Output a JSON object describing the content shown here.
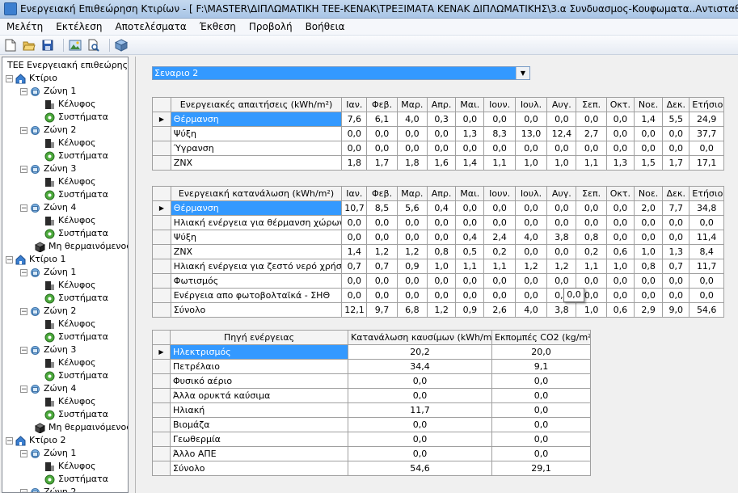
{
  "window": {
    "title": "Ενεργειακή Επιθεώρηση Κτιρίων - [ F:\\MASTER\\ΔΙΠΛΩΜΑΤΙΚΗ ΤΕΕ-ΚΕΝΑΚ\\ΤΡΕΞΙΜΑΤΑ ΚΕΝΑΚ ΔΙΠΛΩΜΑΤΙΚΗΣ\\3.α Συνδυασμος-Κουφωματα..Αντισταθμιση Γ..Ηλιακο"
  },
  "menu": [
    "Μελέτη",
    "Εκτέλεση",
    "Αποτελέσματα",
    "Έκθεση",
    "Προβολή",
    "Βοήθεια"
  ],
  "toolbar": [
    "new-file-icon",
    "open-folder-icon",
    "save-icon",
    "image-icon",
    "print-preview-icon",
    "package-icon"
  ],
  "tree": {
    "root": "ΤΕΕ Ενεργειακή επιθεώρης",
    "buildings": [
      {
        "label": "Κτίριο",
        "zones": [
          {
            "label": "Ζώνη 1",
            "children": [
              "Κέλυφος",
              "Συστήματα"
            ]
          },
          {
            "label": "Ζώνη 2",
            "children": [
              "Κέλυφος",
              "Συστήματα"
            ]
          },
          {
            "label": "Ζώνη 3",
            "children": [
              "Κέλυφος",
              "Συστήματα"
            ]
          },
          {
            "label": "Ζώνη 4",
            "children": [
              "Κέλυφος",
              "Συστήματα"
            ]
          }
        ],
        "unheated": "Μη θερμαινόμενος"
      },
      {
        "label": "Κτίριο 1",
        "zones": [
          {
            "label": "Ζώνη 1",
            "children": [
              "Κέλυφος",
              "Συστήματα"
            ]
          },
          {
            "label": "Ζώνη 2",
            "children": [
              "Κέλυφος",
              "Συστήματα"
            ]
          },
          {
            "label": "Ζώνη 3",
            "children": [
              "Κέλυφος",
              "Συστήματα"
            ]
          },
          {
            "label": "Ζώνη 4",
            "children": [
              "Κέλυφος",
              "Συστήματα"
            ]
          }
        ],
        "unheated": "Μη θερμαινόμενος"
      },
      {
        "label": "Κτίριο 2",
        "zones": [
          {
            "label": "Ζώνη 1",
            "children": [
              "Κέλυφος",
              "Συστήματα"
            ]
          },
          {
            "label": "Ζώνη 2",
            "children": []
          }
        ]
      }
    ]
  },
  "scenario": {
    "selected": "Σεναριο 2"
  },
  "months": [
    "Ιαν.",
    "Φεβ.",
    "Μαρ.",
    "Απρ.",
    "Μαι.",
    "Ιουν.",
    "Ιουλ.",
    "Αυγ.",
    "Σεπ.",
    "Οκτ.",
    "Νοε.",
    "Δεκ.",
    "Ετήσιο"
  ],
  "demands": {
    "header": "Ενεργειακές απαιτήσεις (kWh/m²)",
    "rows": [
      {
        "label": "Θέρμανση",
        "values": [
          "7,6",
          "6,1",
          "4,0",
          "0,3",
          "0,0",
          "0,0",
          "0,0",
          "0,0",
          "0,0",
          "0,0",
          "1,4",
          "5,5",
          "24,9"
        ]
      },
      {
        "label": "Ψύξη",
        "values": [
          "0,0",
          "0,0",
          "0,0",
          "0,0",
          "1,3",
          "8,3",
          "13,0",
          "12,4",
          "2,7",
          "0,0",
          "0,0",
          "0,0",
          "37,7"
        ]
      },
      {
        "label": "Ύγρανση",
        "values": [
          "0,0",
          "0,0",
          "0,0",
          "0,0",
          "0,0",
          "0,0",
          "0,0",
          "0,0",
          "0,0",
          "0,0",
          "0,0",
          "0,0",
          "0,0"
        ]
      },
      {
        "label": "ΖΝΧ",
        "values": [
          "1,8",
          "1,7",
          "1,8",
          "1,6",
          "1,4",
          "1,1",
          "1,0",
          "1,0",
          "1,1",
          "1,3",
          "1,5",
          "1,7",
          "17,1"
        ]
      }
    ]
  },
  "consumption": {
    "header": "Ενεργειακή κατανάλωση (kWh/m²)",
    "rows": [
      {
        "label": "Θέρμανση",
        "values": [
          "10,7",
          "8,5",
          "5,6",
          "0,4",
          "0,0",
          "0,0",
          "0,0",
          "0,0",
          "0,0",
          "0,0",
          "2,0",
          "7,7",
          "34,8"
        ]
      },
      {
        "label": "Ηλιακή ενέργεια για θέρμανση χώρων",
        "values": [
          "0,0",
          "0,0",
          "0,0",
          "0,0",
          "0,0",
          "0,0",
          "0,0",
          "0,0",
          "0,0",
          "0,0",
          "0,0",
          "0,0",
          "0,0"
        ]
      },
      {
        "label": "Ψύξη",
        "values": [
          "0,0",
          "0,0",
          "0,0",
          "0,0",
          "0,4",
          "2,4",
          "4,0",
          "3,8",
          "0,8",
          "0,0",
          "0,0",
          "0,0",
          "11,4"
        ]
      },
      {
        "label": "ΖΝΧ",
        "values": [
          "1,4",
          "1,2",
          "1,2",
          "0,8",
          "0,5",
          "0,2",
          "0,0",
          "0,0",
          "0,2",
          "0,6",
          "1,0",
          "1,3",
          "8,4"
        ]
      },
      {
        "label": "Ηλιακή ενέργεια για ζεστό νερό χρήσης",
        "values": [
          "0,7",
          "0,7",
          "0,9",
          "1,0",
          "1,1",
          "1,1",
          "1,2",
          "1,2",
          "1,1",
          "1,0",
          "0,8",
          "0,7",
          "11,7"
        ]
      },
      {
        "label": "Φωτισμός",
        "values": [
          "0,0",
          "0,0",
          "0,0",
          "0,0",
          "0,0",
          "0,0",
          "0,0",
          "0,0",
          "0,0",
          "0,0",
          "0,0",
          "0,0",
          "0,0"
        ]
      },
      {
        "label": "Ενέργεια απο φωτοβολταϊκά - ΣΗΘ",
        "values": [
          "0,0",
          "0,0",
          "0,0",
          "0,0",
          "0,0",
          "0,0",
          "0,0",
          "0,0",
          "0,0",
          "0,0",
          "0,0",
          "0,0",
          "0,0"
        ]
      },
      {
        "label": "Σύνολο",
        "values": [
          "12,1",
          "9,7",
          "6,8",
          "1,2",
          "0,9",
          "2,6",
          "4,0",
          "3,8",
          "1,0",
          "0,6",
          "2,9",
          "9,0",
          "54,6"
        ]
      }
    ],
    "tooltip": "0,0"
  },
  "sources": {
    "headers": [
      "Πηγή ενέργειας",
      "Κατανάλωση καυσίμων (kWh/m²)",
      "Εκπομπές CO2 (kg/m²)"
    ],
    "rows": [
      {
        "label": "Ηλεκτρισμός",
        "fuel": "20,2",
        "co2": "20,0"
      },
      {
        "label": "Πετρέλαιο",
        "fuel": "34,4",
        "co2": "9,1"
      },
      {
        "label": "Φυσικό αέριο",
        "fuel": "0,0",
        "co2": "0,0"
      },
      {
        "label": "Άλλα ορυκτά καύσιμα",
        "fuel": "0,0",
        "co2": "0,0"
      },
      {
        "label": "Ηλιακή",
        "fuel": "11,7",
        "co2": "0,0"
      },
      {
        "label": "Βιομάζα",
        "fuel": "0,0",
        "co2": "0,0"
      },
      {
        "label": "Γεωθερμία",
        "fuel": "0,0",
        "co2": "0,0"
      },
      {
        "label": "Άλλο ΑΠΕ",
        "fuel": "0,0",
        "co2": "0,0"
      },
      {
        "label": "Σύνολο",
        "fuel": "54,6",
        "co2": "29,1"
      }
    ]
  }
}
